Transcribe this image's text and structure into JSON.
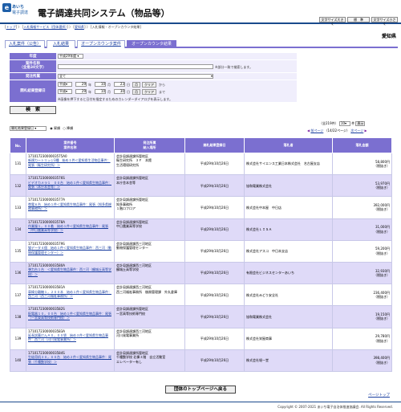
{
  "header": {
    "logo_mark": "e",
    "logo_line1": "あいち",
    "logo_line2": "電子調達",
    "system_title": "電子調達共同システム（物品等）",
    "font_large": "文字サイズ大きく",
    "font_standard": "標　準",
    "font_small": "文字サイズ小さく"
  },
  "breadcrumb": {
    "items": [
      "トップ",
      "入札情報サービス（団体選択）",
      "愛知県",
      "入札情報 - オープンカウンタ結果"
    ],
    "seps": [
      "〉",
      "〉",
      "〉"
    ]
  },
  "prefecture": "愛知県",
  "tabs": [
    {
      "label": "入札案件（公告）"
    },
    {
      "label": "入札結果"
    },
    {
      "label": "オープンカウンタ案件"
    },
    {
      "label": "オープンカウンタ結果"
    }
  ],
  "form": {
    "year_label": "年度",
    "year_value": "平成29年度",
    "case_name_label": "案件名称",
    "case_name_sub": "（全角30文字）",
    "case_name_note": "※部分一致で検索します。",
    "org_label": "発注所属",
    "org_value": "全て",
    "date_label": "開札結果登録日",
    "from_era": "平成",
    "from_year": "29",
    "from_month": "10",
    "from_day": "23",
    "to_era": "平成",
    "to_year": "29",
    "to_month": "10",
    "to_day": "30",
    "unit_year": "年",
    "unit_month": "月",
    "unit_day": "日",
    "calendar_label": "月",
    "clear_label": "クリア",
    "from_suffix": "から",
    "to_suffix": "まで",
    "date_note": "※画像を押下すると日付を指定するためのカレンダーダイアログを表示します。",
    "search_button": "検　索"
  },
  "list_controls": {
    "sort_value": "開札結果登録日",
    "asc_label": "昇順",
    "desc_label": "降順",
    "count_text": "（全219件）",
    "per_page_value": "10",
    "per_page_unit": "件",
    "show_label": "表示",
    "prev_label": "前ページ",
    "page_text": "（14/22ページ）",
    "next_label": "次ページ"
  },
  "table": {
    "headers": [
      "No.",
      "案件番号\n案件名称",
      "発注所属\n納入場所",
      "開札結果登録日",
      "落札者",
      "落札金額"
    ],
    "rows": [
      {
        "no": "131",
        "case_no": "17101723000003575A0",
        "case_name": "新規カートリッジ3種　始め１件＜愛知県生活物品事件：尾張（衛生研究所）＞",
        "org": "会計局調達課所管地区\n衛生研究所　３Ｆ　本館\n生活環境研究所",
        "date": "平成29年10月26日",
        "winner": "株式会社サイエンス工業日本株式会社　名古屋支店",
        "amount": "58,800円",
        "tax": "（税抜き）"
      },
      {
        "no": "132",
        "case_no": "17101723000003576S",
        "case_name": "ビデオカメラ１　００台　始め１件＜愛知県生物品事件：尾張（本庁本舎等）＞",
        "org": "会計局調達課所管地区\n本庁舎本舎等",
        "date": "平成29年10月26日",
        "winner": "協和電業株式会社",
        "amount": "53,970円",
        "tax": "（税抜き）"
      },
      {
        "no": "133",
        "case_no": "17101723000003577A",
        "case_name": "帯電６台　始め１件＜愛知県生物品事件：尾張（知多県総務事務所）＞",
        "org": "会計局調達課所管地区\n知多事務所\n１階ロフロア",
        "date": "平成29年10月26日",
        "winner": "株式会社中本屋　中日店",
        "amount": "392,000円",
        "tax": "（税抜き）"
      },
      {
        "no": "134",
        "case_no": "17101723000003578A",
        "case_name": "作業服１，００着　始め１件＜愛知県生物品事件：尾張（中日農業高等学校）＞",
        "org": "会計局調達課所管地区\n中日農業高等学校",
        "date": "平成29年10月26日",
        "winner": "株式会社ＬＩＳＡ",
        "amount": "31,000円",
        "tax": "（税抜き）"
      },
      {
        "no": "135",
        "case_no": "17101723000003579S",
        "case_name": "猫データ４個　始め１件＜愛知県生物品事件：西三河（動物保護管理センター）＞",
        "org": "会計局調達課西三河地区\n動物保護管理センター",
        "date": "平成29年10月26日",
        "winner": "株式会社アスコ　中日本支店",
        "amount": "59,200円",
        "tax": "（税抜き）"
      },
      {
        "no": "136",
        "case_no": "17101723000003580A",
        "case_name": "弾力台１台　＜愛知県生物品事件：西三河（鶴城丘高等学校）＞",
        "org": "会計局調達課西三河地区\n鶴城丘高等学校",
        "date": "平成29年10月26日",
        "winner": "有限会社ビジネスセンターあいち",
        "amount": "32,930円",
        "tax": "（税抜き）"
      },
      {
        "no": "137",
        "case_no": "17101723000003581A",
        "case_name": "車棒分離機１，２００本　始め１件＜愛知県生物品事件：西三河（西三河福祉事務所）＞",
        "org": "会計局調達課西三河地区\n西三河福祉事務所　後務管理課　外丸倉庫",
        "date": "平成29年10月26日",
        "winner": "株式会社みどり安全社",
        "amount": "236,400円",
        "tax": "（税抜き）"
      },
      {
        "no": "138",
        "case_no": "17101723000003582S",
        "case_name": "配電器１０，００台　始め１件＜愛知県生物品事件：尾張（一宮東高等技術専門校）＞",
        "org": "会計局調達課所管地区\n一宮高等技術専門校",
        "date": "平成29年10月26日",
        "winner": "協和電業株式会社",
        "amount": "19,150円",
        "tax": "（税抜き）"
      },
      {
        "no": "139",
        "case_no": "17101723000003583A",
        "case_name": "延長試薬けんＡ０，００袋　始め３件＜愛知県生物品事件：西三河（河川発電事業所）＞",
        "org": "会計局調達課西三河地区\n河川発電事業所",
        "date": "平成29年10月26日",
        "winner": "株式会社栄屋商事",
        "amount": "29,780円",
        "tax": "（税抜き）"
      },
      {
        "no": "140",
        "case_no": "17101723000003584S",
        "case_name": "生徒用机３０，００台　始め２件＜愛知県生物品事件：尾張（千種聾学校）＞",
        "org": "会計局調達課所管地区\n千種聾学校 北棟３階　自立活動室\nエレベーター有し",
        "date": "平成29年10月26日",
        "winner": "株式会社堀一堂",
        "amount": "398,400円",
        "tax": "（税抜き）"
      }
    ]
  },
  "back_button": "団体のトップページへ戻る",
  "page_top": "ページトップ",
  "footer": "Copyright © 2007-2021 あいち電子自治体推進協議会. All Rights Reserved.",
  "colors": {
    "accent": "#7b6fd0",
    "row_alt": "#dfdaf8",
    "brand": "#1f5fa8"
  }
}
